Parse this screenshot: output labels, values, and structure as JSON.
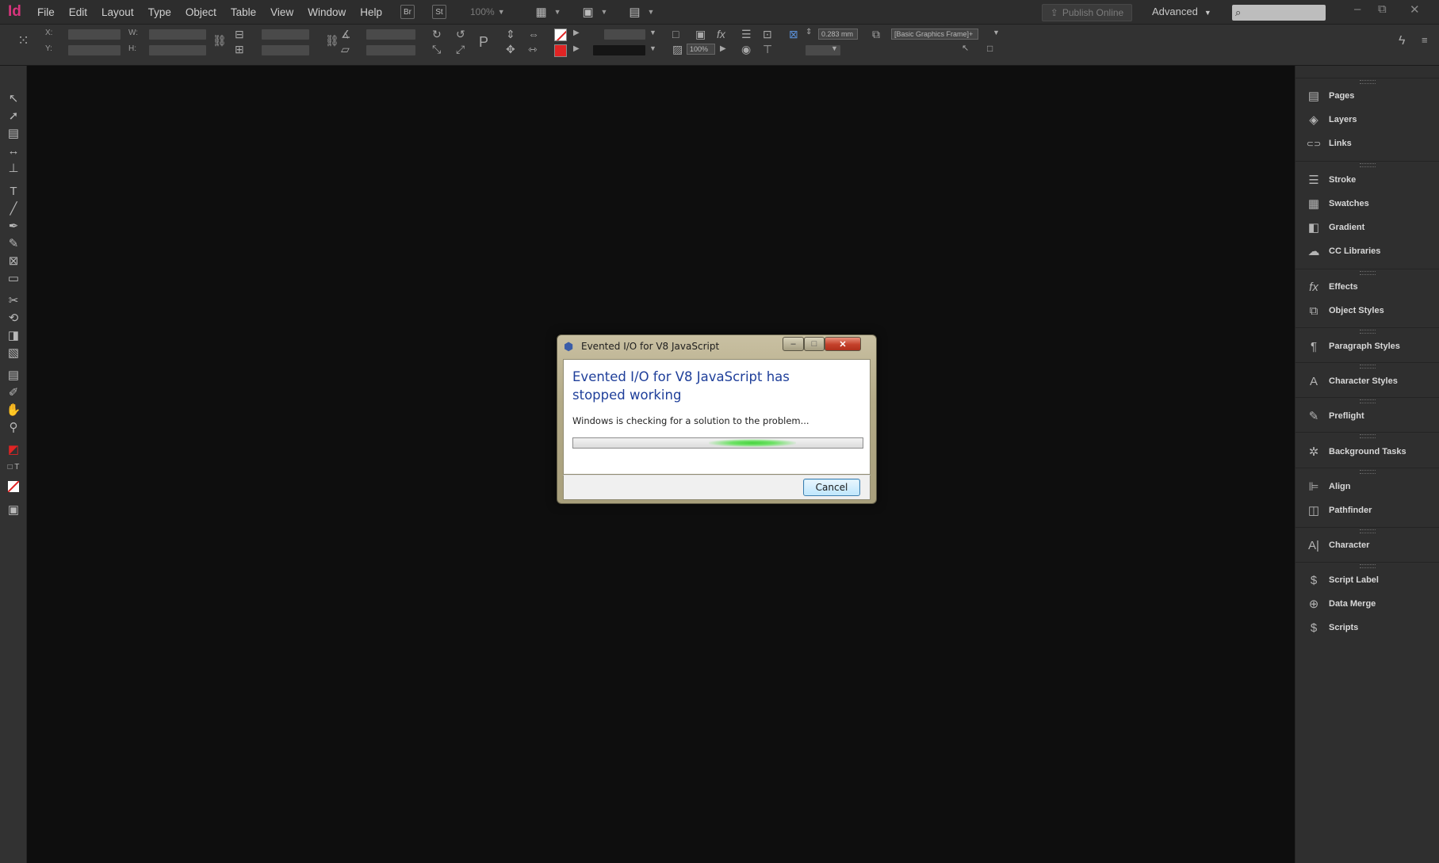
{
  "app": {
    "logo": "Id"
  },
  "menubar": {
    "items": [
      "File",
      "Edit",
      "Layout",
      "Type",
      "Object",
      "Table",
      "View",
      "Window",
      "Help"
    ],
    "bridge_label": "Br",
    "stock_label": "St",
    "zoom": "100%",
    "publish_label": "Publish Online",
    "workspace_label": "Advanced"
  },
  "control": {
    "x_label": "X:",
    "y_label": "Y:",
    "w_label": "W:",
    "h_label": "H:",
    "stroke_weight": "0.283 mm",
    "opacity": "100%",
    "object_style": "[Basic Graphics Frame]+"
  },
  "panels": [
    {
      "icon": "pages-icon",
      "glyph": "▤",
      "label": "Pages"
    },
    {
      "icon": "layers-icon",
      "glyph": "◈",
      "label": "Layers"
    },
    {
      "icon": "links-icon",
      "glyph": "⊂⊃",
      "label": "Links"
    },
    {
      "icon": "stroke-icon",
      "glyph": "☰",
      "label": "Stroke"
    },
    {
      "icon": "swatches-icon",
      "glyph": "▦",
      "label": "Swatches"
    },
    {
      "icon": "gradient-icon",
      "glyph": "◧",
      "label": "Gradient"
    },
    {
      "icon": "cc-libraries-icon",
      "glyph": "☁",
      "label": "CC Libraries"
    },
    {
      "icon": "effects-icon",
      "glyph": "fx",
      "label": "Effects"
    },
    {
      "icon": "object-styles-icon",
      "glyph": "⧉",
      "label": "Object Styles"
    },
    {
      "icon": "paragraph-styles-icon",
      "glyph": "¶",
      "label": "Paragraph Styles"
    },
    {
      "icon": "character-styles-icon",
      "glyph": "A",
      "label": "Character Styles"
    },
    {
      "icon": "preflight-icon",
      "glyph": "✎",
      "label": "Preflight"
    },
    {
      "icon": "background-tasks-icon",
      "glyph": "✲",
      "label": "Background Tasks"
    },
    {
      "icon": "align-icon",
      "glyph": "⊫",
      "label": "Align"
    },
    {
      "icon": "pathfinder-icon",
      "glyph": "◫",
      "label": "Pathfinder"
    },
    {
      "icon": "character-icon",
      "glyph": "A|",
      "label": "Character"
    },
    {
      "icon": "script-label-icon",
      "glyph": "$",
      "label": "Script Label"
    },
    {
      "icon": "data-merge-icon",
      "glyph": "⊕",
      "label": "Data Merge"
    },
    {
      "icon": "scripts-icon",
      "glyph": "$",
      "label": "Scripts"
    }
  ],
  "dialog": {
    "title": "Evented I/O for V8 JavaScript",
    "heading": "Evented I/O for V8 JavaScript has stopped working",
    "message": "Windows is checking for a solution to the problem...",
    "cancel_label": "Cancel",
    "close_glyph": "✕",
    "minimize_glyph": "–",
    "maximize_glyph": "□",
    "progress_position": 0.62
  },
  "colors": {
    "accent": "#d6357c",
    "dialog_heading": "#1f3f9a",
    "progress_glow": "#46d23e"
  }
}
